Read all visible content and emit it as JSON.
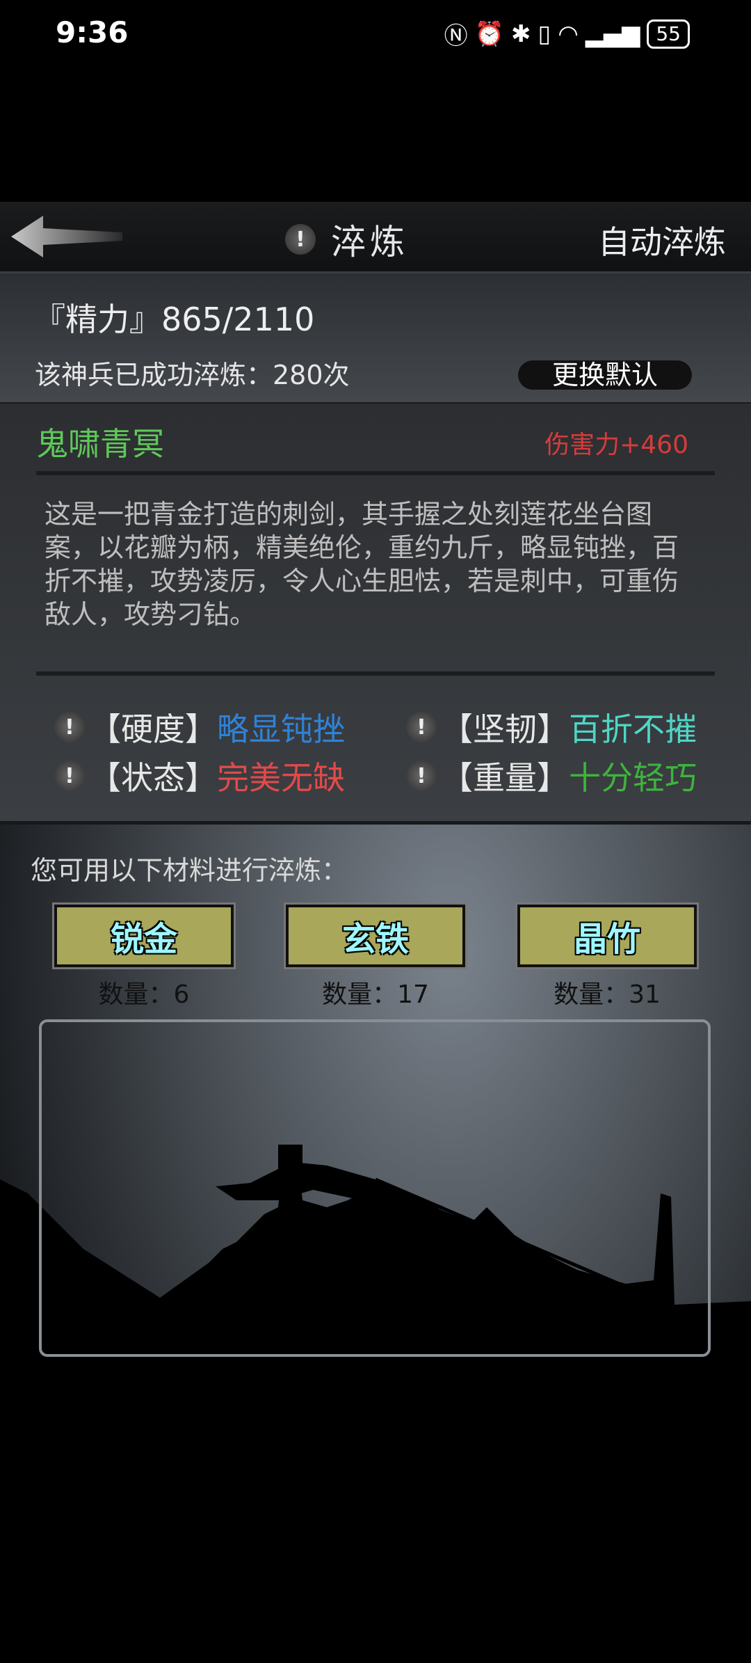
{
  "status": {
    "time": "9:36",
    "battery": "55"
  },
  "header": {
    "title": "淬炼",
    "auto_label": "自动淬炼"
  },
  "stats": {
    "energy": "『精力』865/2110",
    "count": "该神兵已成功淬炼：280次",
    "change_button": "更换默认"
  },
  "weapon": {
    "name": "鬼啸青冥",
    "damage": "伤害力+460",
    "description": "这是一把青金打造的刺剑，其手握之处刻莲花坐台图案，以花瓣为柄，精美绝伦，重约九斤，略显钝挫，百折不摧，攻势凌厉，令人心生胆怯，若是刺中，可重伤敌人，攻势刁钻。",
    "attributes": [
      {
        "label": "【硬度】",
        "value": "略显钝挫",
        "color": "#2f82d6"
      },
      {
        "label": "【坚韧】",
        "value": "百折不摧",
        "color": "#4fd6c6"
      },
      {
        "label": "【状态】",
        "value": "完美无缺",
        "color": "#e24a4a"
      },
      {
        "label": "【重量】",
        "value": "十分轻巧",
        "color": "#3db43d"
      }
    ]
  },
  "materials": {
    "label": "您可用以下材料进行淬炼：",
    "items": [
      {
        "name": "锐金",
        "qty": "数量：6"
      },
      {
        "name": "玄铁",
        "qty": "数量：17"
      },
      {
        "name": "晶竹",
        "qty": "数量：31"
      }
    ]
  },
  "icons": {
    "back": "back-arrow-icon",
    "info": "exclamation-icon"
  }
}
